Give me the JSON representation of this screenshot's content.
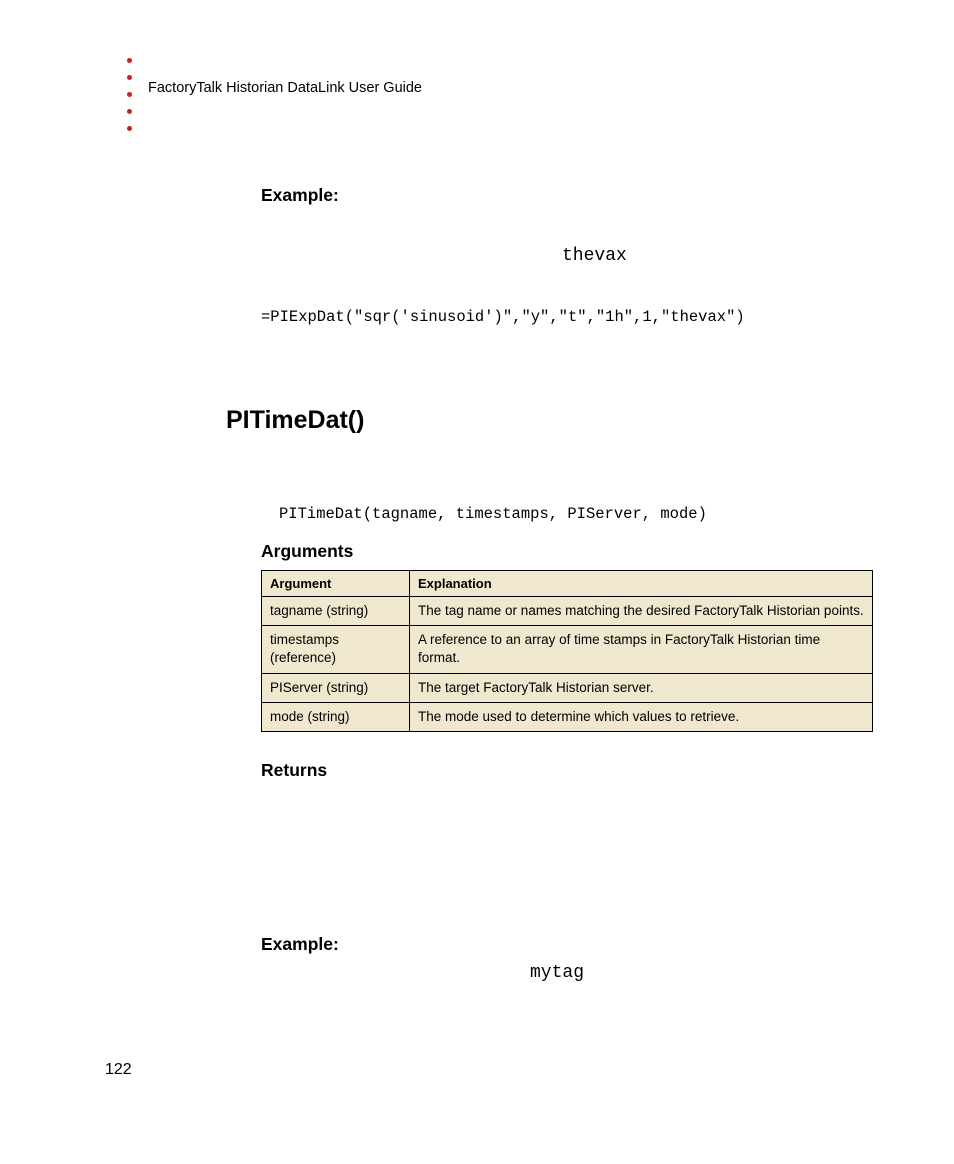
{
  "header": {
    "guide_title": "FactoryTalk Historian DataLink User Guide"
  },
  "example1": {
    "heading": "Example:",
    "ghost": "thevax",
    "formula": "=PIExpDat(\"sqr('sinusoid')\",\"y\",\"t\",\"1h\",1,\"thevax\")"
  },
  "section": {
    "title": "PITimeDat()",
    "syntax": "PITimeDat(tagname, timestamps, PIServer, mode)"
  },
  "arguments": {
    "heading": "Arguments",
    "columns": {
      "arg": "Argument",
      "exp": "Explanation"
    },
    "rows": [
      {
        "arg": "tagname (string)",
        "exp": "The tag name or names matching the desired FactoryTalk Historian points."
      },
      {
        "arg": "timestamps (reference)",
        "exp": "A reference to an array of time stamps in FactoryTalk Historian time format."
      },
      {
        "arg": "PIServer (string)",
        "exp": "The target FactoryTalk Historian server."
      },
      {
        "arg": "mode (string)",
        "exp": "The mode used to determine which values to retrieve."
      }
    ]
  },
  "returns": {
    "heading": "Returns"
  },
  "example2": {
    "heading": "Example:",
    "ghost": "mytag"
  },
  "page_number": "122"
}
